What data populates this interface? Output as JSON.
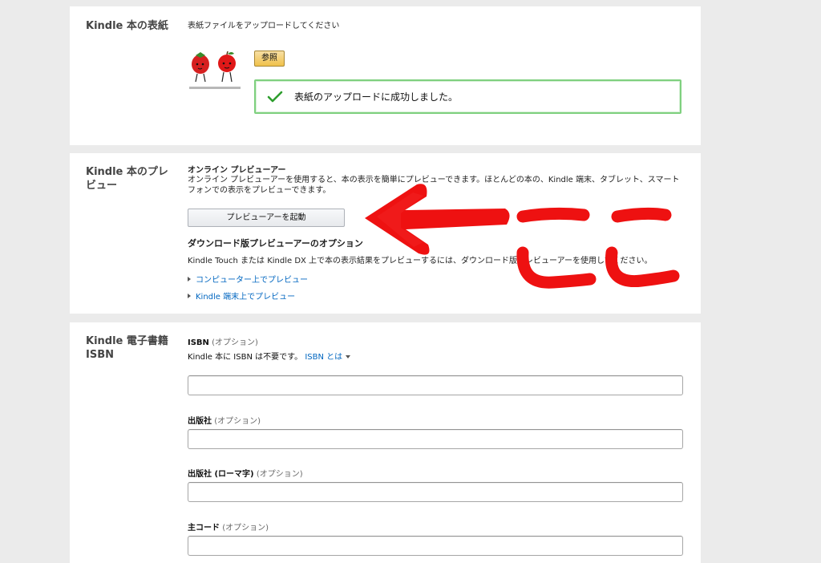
{
  "cover_section": {
    "title": "Kindle 本の表紙",
    "instruction": "表紙ファイルをアップロードしてください",
    "browse_button": "参照",
    "success_message": "表紙のアップロードに成功しました。",
    "success_color": "#2e9e2e"
  },
  "preview_section": {
    "title": "Kindle 本のプレビュー",
    "online_heading": "オンライン プレビューアー",
    "online_desc": "オンライン プレビューアーを使用すると、本の表示を簡単にプレビューできます。ほとんどの本の、Kindle 端末、タブレット、スマートフォンでの表示をプレビューできます。",
    "launch_button": "プレビューアーを起動",
    "download_heading": "ダウンロード版プレビューアーのオプション",
    "download_desc": "Kindle Touch または Kindle DX 上で本の表示結果をプレビューするには、ダウンロード版プレビューアーを使用してください。",
    "link_computer": "コンピューター上でプレビュー",
    "link_kindle": "Kindle 端末上でプレビュー"
  },
  "isbn_section": {
    "title": "Kindle 電子書籍 ISBN",
    "isbn_label": "ISBN",
    "optional": "(オプション)",
    "isbn_note": "Kindle 本に ISBN は不要です。",
    "isbn_help_link": "ISBN とは",
    "publisher_label": "出版社",
    "publisher_romaji_label": "出版社 (ローマ字)",
    "main_code_label": "主コード"
  },
  "annotation": {
    "text": "ここ",
    "color": "#ee1111"
  }
}
